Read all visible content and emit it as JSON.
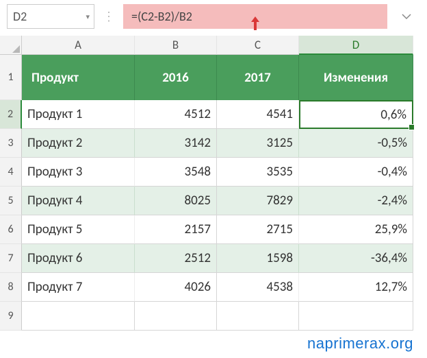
{
  "name_box": "D2",
  "formula": "=(C2-B2)/B2",
  "columns": {
    "A": "A",
    "B": "B",
    "C": "C",
    "D": "D"
  },
  "row_numbers": [
    "1",
    "2",
    "3",
    "4",
    "5",
    "6",
    "7",
    "8",
    "9"
  ],
  "header": {
    "A": "Продукт",
    "B": "2016",
    "C": "2017",
    "D": "Изменения"
  },
  "rows": [
    {
      "A": "Продукт 1",
      "B": "4512",
      "C": "4541",
      "D": "0,6%"
    },
    {
      "A": "Продукт 2",
      "B": "3142",
      "C": "3125",
      "D": "-0,5%"
    },
    {
      "A": "Продукт 3",
      "B": "3548",
      "C": "3535",
      "D": "-0,4%"
    },
    {
      "A": "Продукт 4",
      "B": "8025",
      "C": "7829",
      "D": "-2,4%"
    },
    {
      "A": "Продукт 5",
      "B": "2157",
      "C": "2715",
      "D": "25,9%"
    },
    {
      "A": "Продукт 6",
      "B": "2512",
      "C": "1598",
      "D": "-36,4%"
    },
    {
      "A": "Продукт 7",
      "B": "4026",
      "C": "4538",
      "D": "12,7%"
    }
  ],
  "watermark": "naprimerax.org"
}
